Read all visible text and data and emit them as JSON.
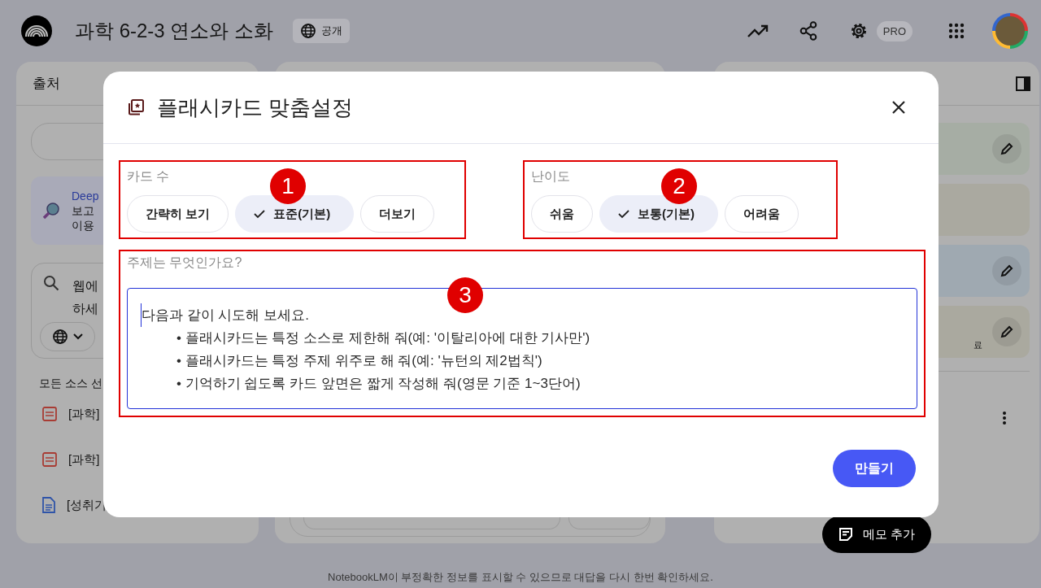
{
  "header": {
    "title": "과학 6-2-3 연소와 소화",
    "visibility": "공개",
    "plan_badge": "PRO"
  },
  "sources": {
    "title": "출처",
    "research_card": {
      "title": "Deep",
      "lines": [
        "보고",
        "이용"
      ]
    },
    "web_search": {
      "lines": [
        "웹에",
        "하세"
      ]
    },
    "select_all": "모든 소스 선",
    "items": [
      {
        "kind": "pdf",
        "title": "[과학]"
      },
      {
        "kind": "pdf",
        "title": "[과학]"
      },
      {
        "kind": "doc",
        "title": "[성취기"
      }
    ]
  },
  "studio": {
    "notes": [
      {
        "color": "#a6ada4",
        "editable": true
      },
      {
        "color": "#aaa9a0",
        "editable": false
      },
      {
        "color": "#9fa9b1",
        "editable": true
      },
      {
        "color": "#aaa99f",
        "editable": true
      }
    ],
    "note_fragment": "료",
    "add_note": "메모 추가"
  },
  "dialog": {
    "title": "플래시카드 맞춤설정",
    "card_count": {
      "label": "카드 수",
      "annotation": "1",
      "options": [
        {
          "label": "간략히 보기",
          "selected": false
        },
        {
          "label": "표준(기본)",
          "selected": true
        },
        {
          "label": "더보기",
          "selected": false
        }
      ]
    },
    "difficulty": {
      "label": "난이도",
      "annotation": "2",
      "options": [
        {
          "label": "쉬움",
          "selected": false
        },
        {
          "label": "보통(기본)",
          "selected": true
        },
        {
          "label": "어려움",
          "selected": false
        }
      ]
    },
    "topic": {
      "label": "주제는 무엇인가요?",
      "annotation": "3",
      "hint_intro": "다음과 같이 시도해 보세요.",
      "hint_bullets": [
        "• 플래시카드는 특정 소스로 제한해 줘(예: '이탈리아에 대한 기사만')",
        "• 플래시카드는 특정 주제 위주로 해 줘(예: '뉴턴의 제2법칙')",
        "• 기억하기 쉽도록 카드 앞면은 짧게 작성해 줘(영문 기준 1~3단어)"
      ]
    },
    "create_button": "만들기"
  },
  "footer": "NotebookLM이 부정확한 정보를 표시할 수 있으므로 대답을 다시 한번 확인하세요."
}
